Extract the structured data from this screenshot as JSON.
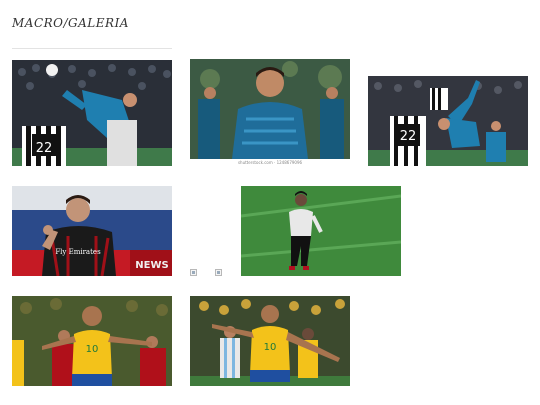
{
  "page": {
    "title": "MACRO/GALERIA"
  },
  "gallery": {
    "photos": [
      {
        "id": "photo-1",
        "subject": "Bicycle kick vs Juventus, stadium crowd",
        "jersey_text": "22"
      },
      {
        "id": "photo-2",
        "subject": "Player in blue training top smiling",
        "caption": "shutterstock.com · 1248679096"
      },
      {
        "id": "photo-3",
        "subject": "Overhead kick in white kit vs Juventus",
        "jersey_text": "22"
      },
      {
        "id": "photo-4",
        "subject": "Player in red-black kit celebrating",
        "sponsor_text": "Fly Emirates",
        "board_text": "NEWS"
      },
      {
        "id": "photo-5",
        "subject": "Player in white and black on grass pitch"
      },
      {
        "id": "photo-6",
        "subject": "Brazil player in yellow shirt",
        "jersey_text": "10"
      },
      {
        "id": "photo-7",
        "subject": "Brazil player in yellow shirt arms out",
        "jersey_text": "10"
      }
    ],
    "broken_images": 2
  },
  "colors": {
    "blue_kit": "#1f7fb0",
    "yellow_kit": "#f3c21a",
    "red_kit": "#b0101a"
  }
}
